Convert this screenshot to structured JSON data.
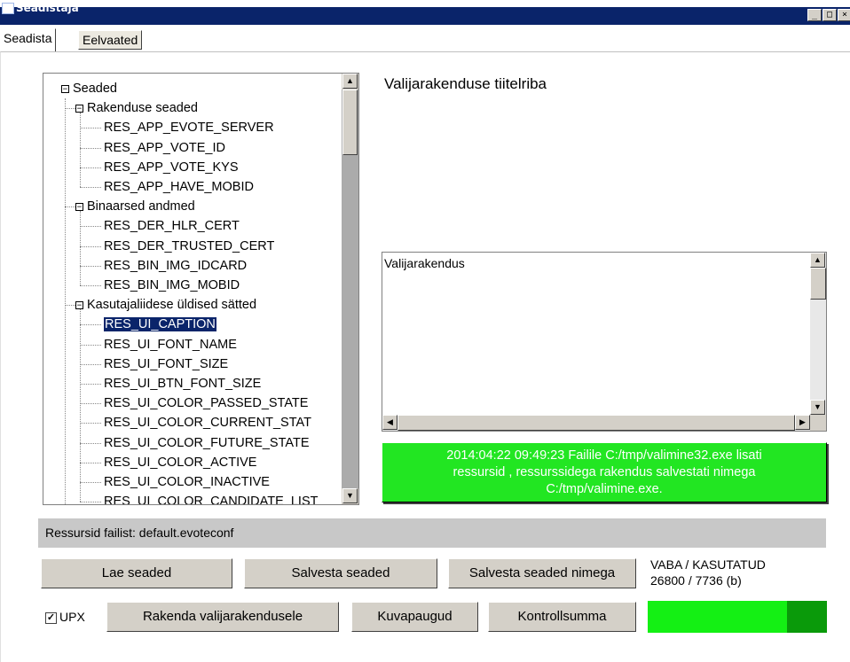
{
  "window": {
    "title": "Seadistaja",
    "buttons": [
      "_",
      "□",
      "×"
    ]
  },
  "tabs": [
    "Seadista",
    "Eelvaated"
  ],
  "tree": {
    "root": "Seaded",
    "groups": [
      {
        "label": "Rakenduse seaded",
        "items": [
          "RES_APP_EVOTE_SERVER",
          "RES_APP_VOTE_ID",
          "RES_APP_VOTE_KYS",
          "RES_APP_HAVE_MOBID"
        ]
      },
      {
        "label": "Binaarsed andmed",
        "items": [
          "RES_DER_HLR_CERT",
          "RES_DER_TRUSTED_CERT",
          "RES_BIN_IMG_IDCARD",
          "RES_BIN_IMG_MOBID"
        ]
      },
      {
        "label": "Kasutajaliidese üldised sätted",
        "items": [
          "RES_UI_CAPTION",
          "RES_UI_FONT_NAME",
          "RES_UI_FONT_SIZE",
          "RES_UI_BTN_FONT_SIZE",
          "RES_UI_COLOR_PASSED_STATE",
          "RES_UI_COLOR_CURRENT_STAT",
          "RES_UI_COLOR_FUTURE_STATE",
          "RES_UI_COLOR_ACTIVE",
          "RES_UI_COLOR_INACTIVE",
          "RES_UI_COLOR_CANDIDATE_LIST"
        ]
      }
    ],
    "selected": "RES_UI_CAPTION"
  },
  "preview": {
    "title": "Valijarakenduse tiitelriba",
    "value": "Valijarakendus"
  },
  "status": {
    "lines": [
      "2014:04:22 09:49:23    Failile C:/tmp/valimine32.exe lisati",
      "ressursid , ressurssidega rakendus salvestati nimega",
      "C:/tmp/valimine.exe."
    ]
  },
  "source": "Ressursid failist: default.evoteconf",
  "buttons": {
    "load": "Lae seaded",
    "save": "Salvesta seaded",
    "save_as": "Salvesta seaded nimega",
    "apply": "Rakenda valijarakendusele",
    "images": "Kuvapaugud",
    "checksum": "Kontrollsumma"
  },
  "upx": {
    "label": "UPX",
    "checked": true
  },
  "space": {
    "label": "VABA / KASUTATUD",
    "value": "26800 / 7736 (b)",
    "used_fraction": 0.224
  },
  "colors": {
    "titlebar": "#0a246a",
    "status_bg": "#22e622",
    "usage_free": "#14f014",
    "usage_used": "#0a9a0a"
  }
}
